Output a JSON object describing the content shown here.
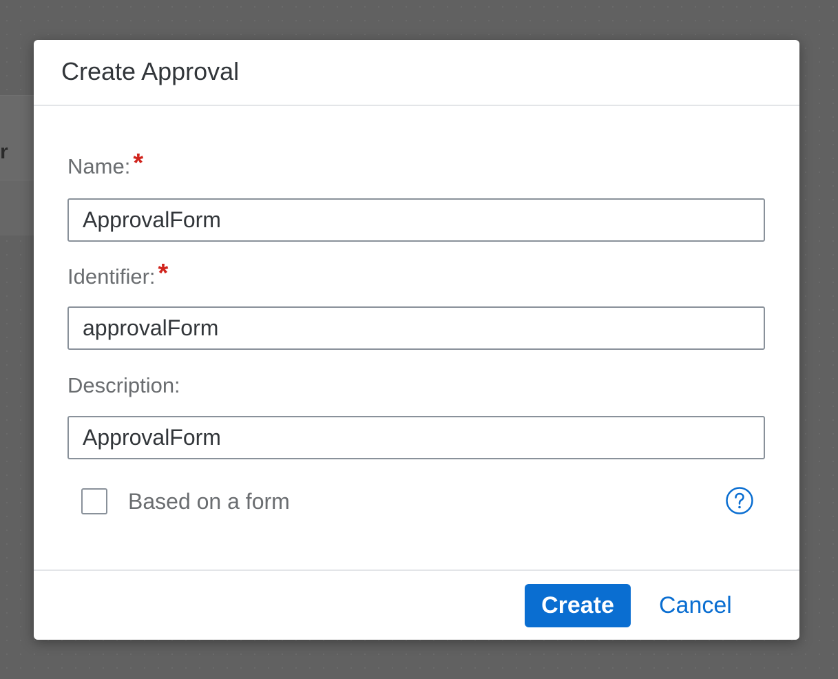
{
  "background": {
    "partial_text": "r"
  },
  "dialog": {
    "title": "Create Approval",
    "fields": {
      "name": {
        "label": "Name:",
        "required_marker": "*",
        "value": "ApprovalForm"
      },
      "identifier": {
        "label": "Identifier:",
        "required_marker": "*",
        "value": "approvalForm"
      },
      "description": {
        "label": "Description:",
        "value": "ApprovalForm"
      }
    },
    "based_on_form": {
      "label": "Based on a form",
      "checked": false
    },
    "help_icon": "question-circle-icon",
    "footer": {
      "create_label": "Create",
      "cancel_label": "Cancel"
    }
  },
  "colors": {
    "accent": "#0a6ed1",
    "required": "#d0231c",
    "overlay": "#616161"
  }
}
